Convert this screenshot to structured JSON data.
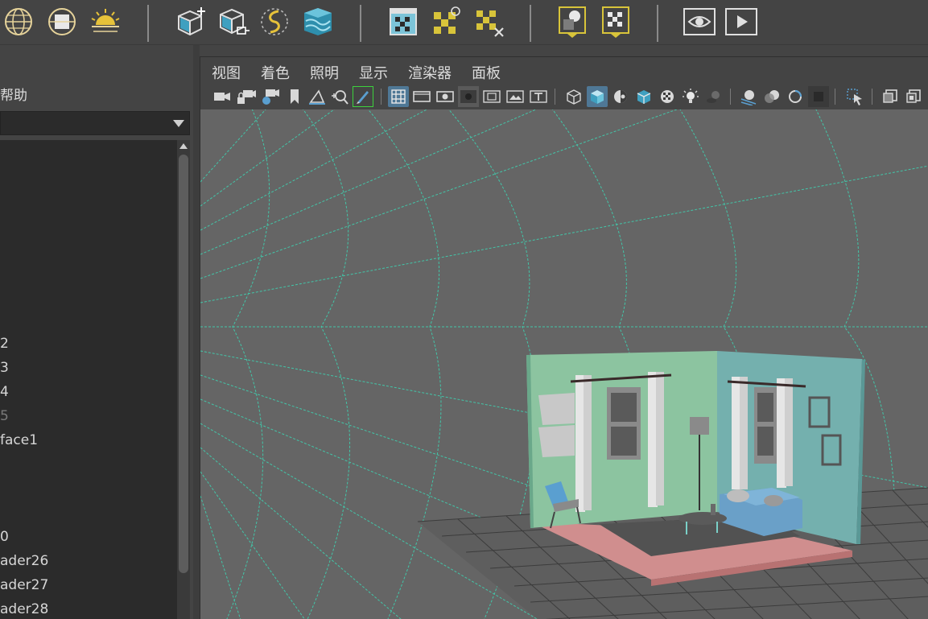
{
  "shelf": {
    "icons": [
      "wireframe-sphere-icon",
      "flat-sphere-icon",
      "sun-horizon-icon",
      "cube-create-icon",
      "cube-export-icon",
      "curve-paint-icon",
      "water-cube-icon",
      "texture-grid-icon",
      "checker-move-icon",
      "checker-delete-icon",
      "shader-sphere-icon",
      "checker-down-icon",
      "eye-visibility-icon",
      "playblast-icon"
    ]
  },
  "left_panel": {
    "menu_label": "帮助",
    "list_items": [
      {
        "text": "2",
        "dim": false
      },
      {
        "text": "3",
        "dim": false
      },
      {
        "text": "4",
        "dim": false
      },
      {
        "text": "5",
        "dim": true
      },
      {
        "text": "face1",
        "dim": false
      },
      {
        "text": "0",
        "dim": false
      },
      {
        "text": "ader26",
        "dim": false
      },
      {
        "text": "ader27",
        "dim": false
      },
      {
        "text": "ader28",
        "dim": false
      }
    ]
  },
  "viewport": {
    "menus": [
      "视图",
      "着色",
      "照明",
      "显示",
      "渲染器",
      "面板"
    ],
    "toolbar_icons": [
      "select-camera-icon",
      "lock-camera-icon",
      "camera-attributes-icon",
      "bookmark-icon",
      "image-plane-icon",
      "2d-pan-zoom-icon",
      "grease-pencil-icon",
      "grid-icon",
      "film-gate-icon",
      "resolution-gate-icon",
      "gate-mask-icon",
      "field-chart-icon",
      "safe-action-icon",
      "safe-title-icon",
      "wireframe-icon",
      "smooth-shade-icon",
      "default-material-icon",
      "wireframe-on-shaded-icon",
      "textured-icon",
      "use-all-lights-icon",
      "shadows-icon",
      "screen-ao-icon",
      "motion-blur-icon",
      "anti-alias-icon",
      "isolate-icon",
      "xray-icon",
      "select-tool-icon",
      "two-panes-icon",
      "four-panes-icon"
    ]
  },
  "colors": {
    "ui_bg": "#444444",
    "panel_dark": "#2b2b2b",
    "viewport_bg": "#656565",
    "camera_curves": "#3fd0b0",
    "active_button": "#4f7896",
    "highlight": "#3dd13d",
    "shelf_blue": "#3fa0c0",
    "shelf_yellow": "#d8c43a"
  }
}
